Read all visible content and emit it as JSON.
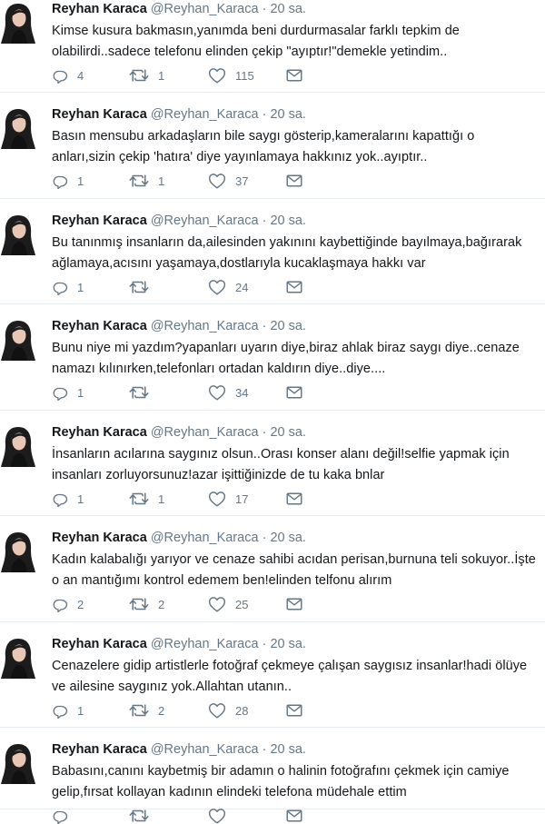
{
  "tweets": [
    {
      "name": "Reyhan Karaca",
      "handle": "@Reyhan_Karaca",
      "dot": "·",
      "time": "20 sa.",
      "text": "Kimse kusura bakmasın,yanımda beni durdurmasalar farklı tepkim de olabilirdi..sadece telefonu elinden çekip \"ayıptır!\"demekle yetindim..",
      "replies": "4",
      "retweets": "1",
      "likes": "115"
    },
    {
      "name": "Reyhan Karaca",
      "handle": "@Reyhan_Karaca",
      "dot": "·",
      "time": "20 sa.",
      "text": "Basın mensubu arkadaşların bile saygı gösterip,kameralarını kapattığı o anları,sizin çekip 'hatıra' diye yayınlamaya hakkınız yok..ayıptır..",
      "replies": "1",
      "retweets": "1",
      "likes": "37"
    },
    {
      "name": "Reyhan Karaca",
      "handle": "@Reyhan_Karaca",
      "dot": "·",
      "time": "20 sa.",
      "text": "Bu tanınmış insanların da,ailesinden yakınını kaybettiğinde bayılmaya,bağırarak ağlamaya,acısını yaşamaya,dostlarıyla kucaklaşmaya hakkı var",
      "replies": "1",
      "retweets": "",
      "likes": "24"
    },
    {
      "name": "Reyhan Karaca",
      "handle": "@Reyhan_Karaca",
      "dot": "·",
      "time": "20 sa.",
      "text": "Bunu niye mi yazdım?yapanları uyarın diye,biraz ahlak biraz saygı diye..cenaze namazı kılınırken,telefonları ortadan kaldırın diye..diye....",
      "replies": "1",
      "retweets": "",
      "likes": "34"
    },
    {
      "name": "Reyhan Karaca",
      "handle": "@Reyhan_Karaca",
      "dot": "·",
      "time": "20 sa.",
      "text": "İnsanların acılarına saygınız olsun..Orası konser alanı değil!selfie yapmak için insanları zorluyorsunuz!azar işittiğinizde de tu kaka bnlar",
      "replies": "1",
      "retweets": "1",
      "likes": "17"
    },
    {
      "name": "Reyhan Karaca",
      "handle": "@Reyhan_Karaca",
      "dot": "·",
      "time": "20 sa.",
      "text": "Kadın kalabalığı yarıyor ve cenaze sahibi acıdan perisan,burnuna teli sokuyor..İşte o an mantığımı kontrol edemem ben!elinden telfonu alırım",
      "replies": "2",
      "retweets": "2",
      "likes": "25"
    },
    {
      "name": "Reyhan Karaca",
      "handle": "@Reyhan_Karaca",
      "dot": "·",
      "time": "20 sa.",
      "text": "Cenazelere gidip artistlerle fotoğraf çekmeye çalışan saygısız insanlar!hadi ölüye ve ailesine saygınız yok.Allahtan utanın..",
      "replies": "1",
      "retweets": "2",
      "likes": "28"
    },
    {
      "name": "Reyhan Karaca",
      "handle": "@Reyhan_Karaca",
      "dot": "·",
      "time": "20 sa.",
      "text": "Babasını,canını kaybetmiş bir adamın o halinin fotoğrafını çekmek için camiye gelip,fırsat kollayan kadının elindeki telefona müdehale ettim",
      "replies": "",
      "retweets": "",
      "likes": ""
    }
  ],
  "icons": {
    "reply": "reply-icon",
    "retweet": "retweet-icon",
    "like": "heart-icon",
    "message": "envelope-icon"
  },
  "colors": {
    "text": "#14171a",
    "muted": "#657786",
    "divider": "#e6ecf0"
  }
}
